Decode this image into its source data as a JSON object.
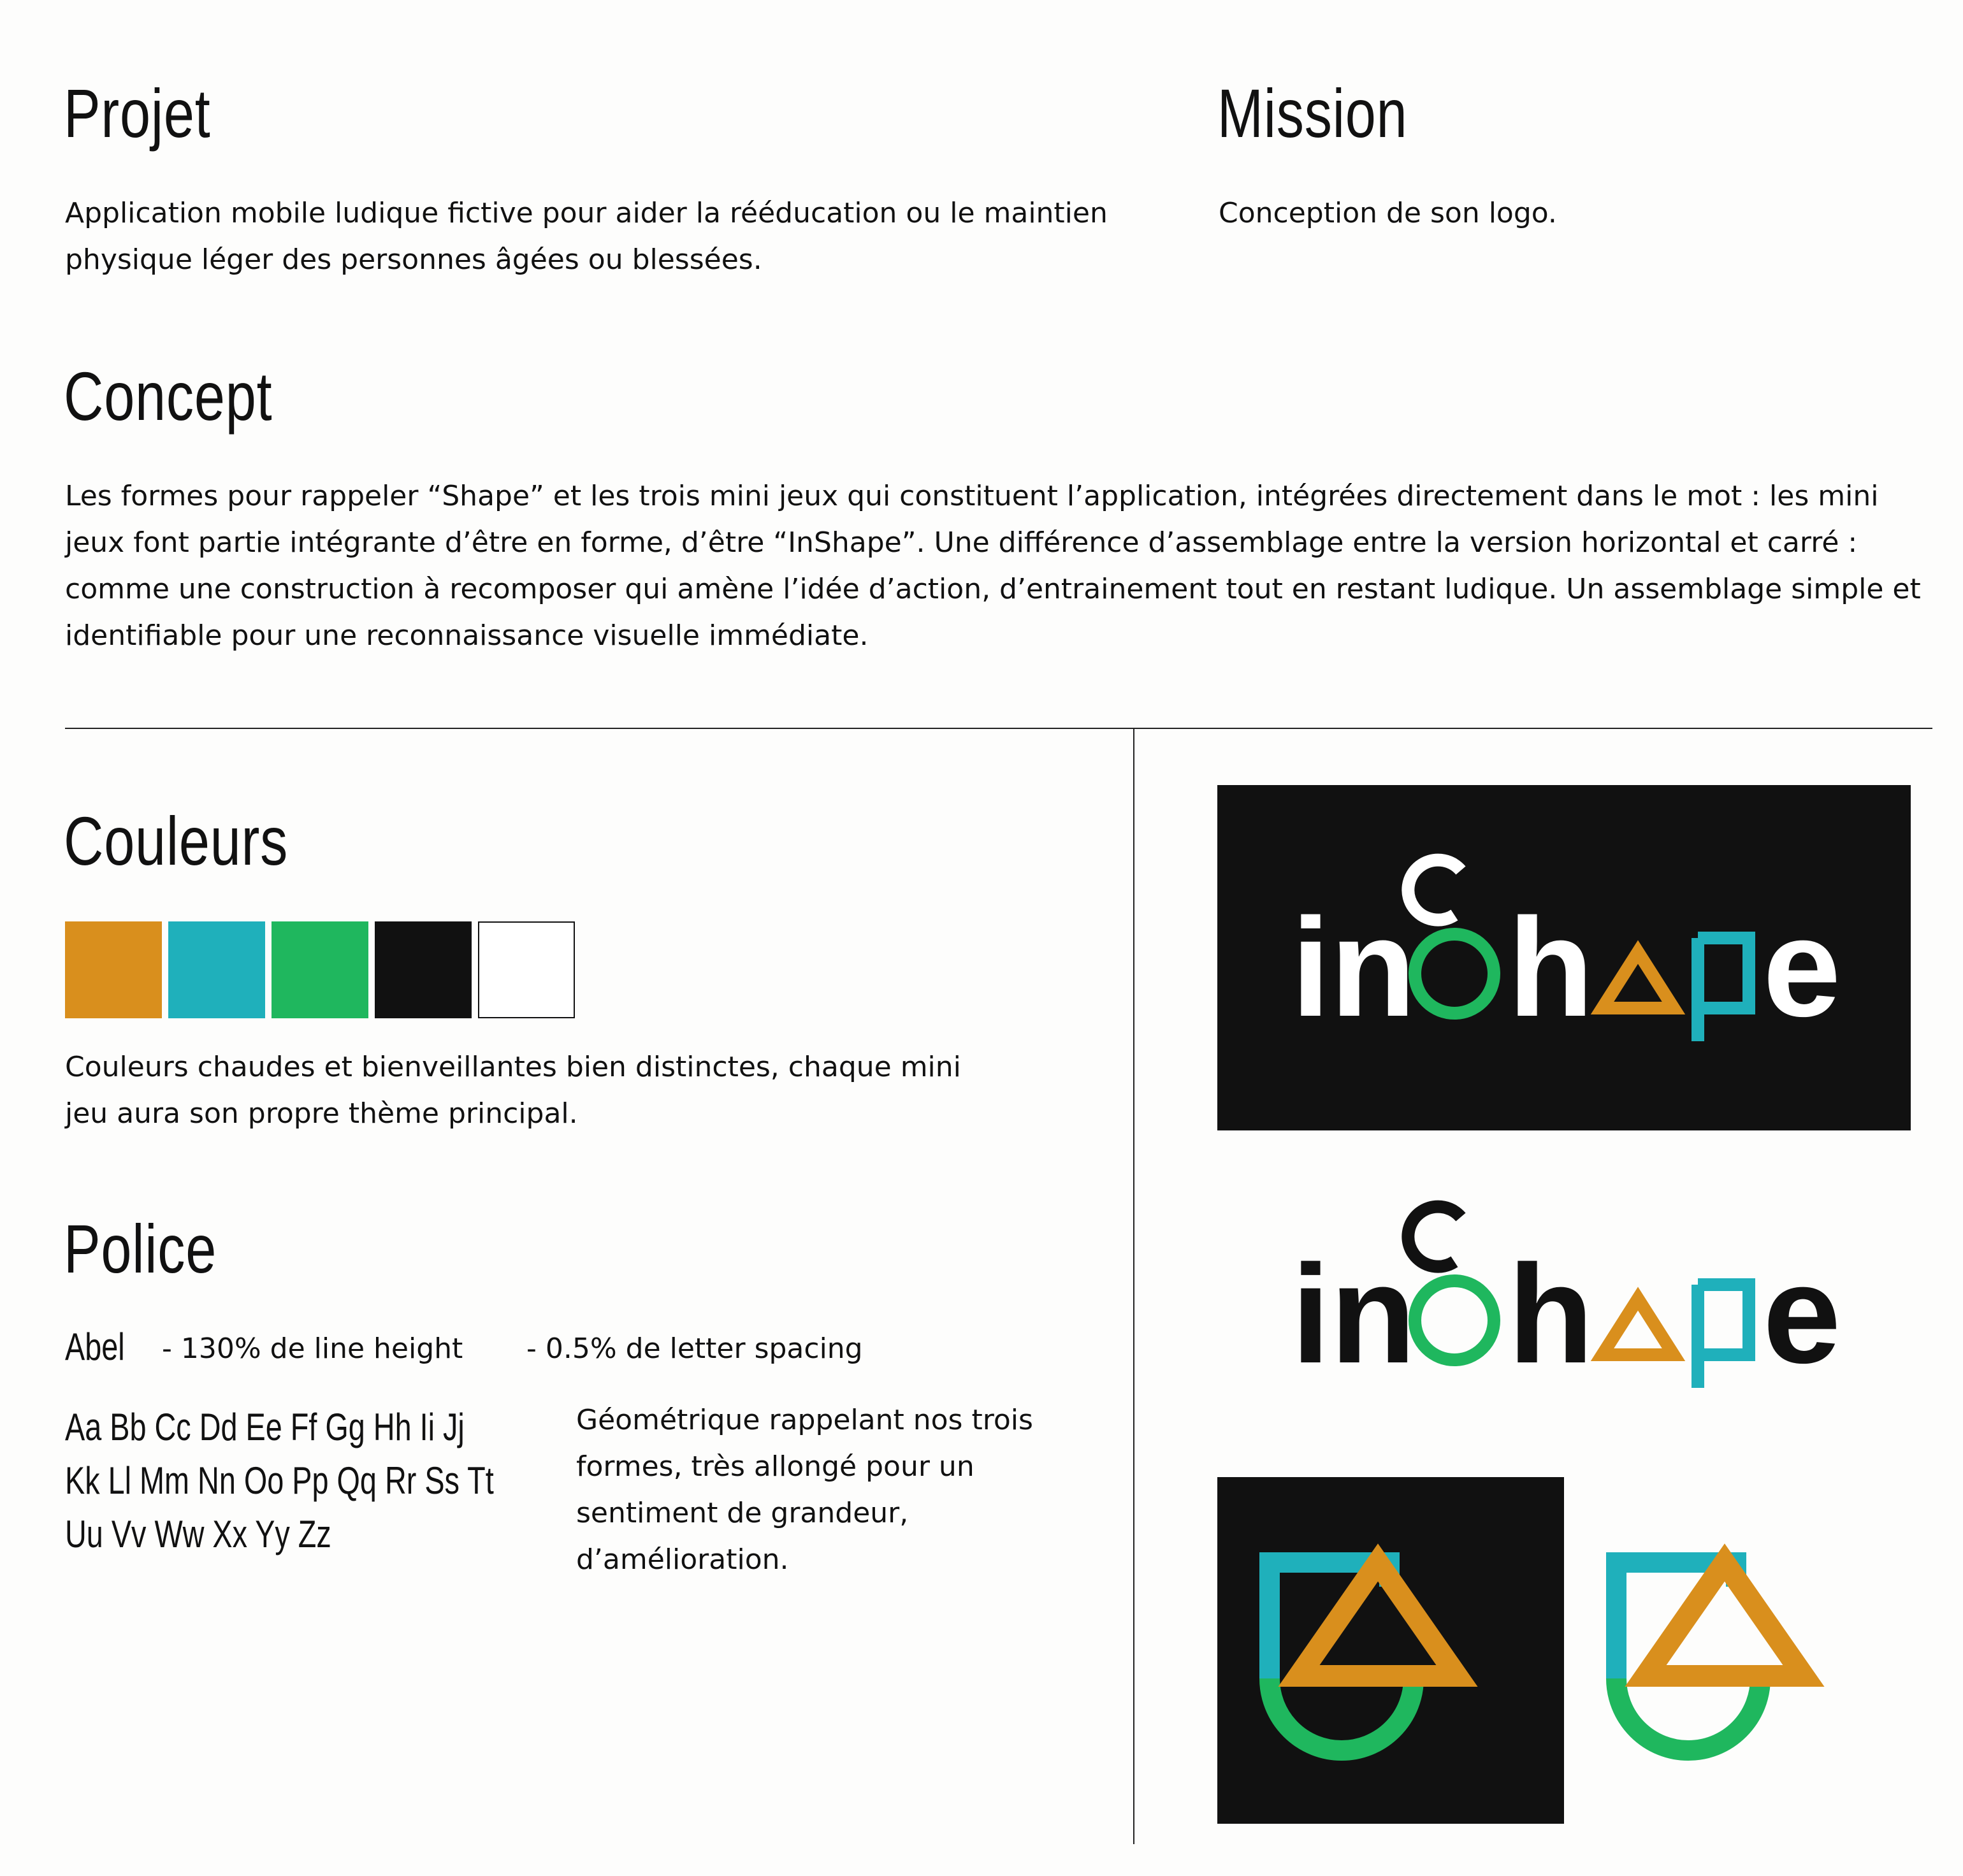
{
  "projet": {
    "title": "Projet",
    "text": "Application mobile ludique fictive pour aider la rééducation ou le maintien physique léger des personnes âgées ou blessées."
  },
  "mission": {
    "title": "Mission",
    "text": "Conception de son logo."
  },
  "concept": {
    "title": "Concept",
    "text": "Les formes pour rappeler “Shape” et les trois mini jeux qui constituent l’application, intégrées directement dans le mot : les mini jeux font partie intégrante d’être en forme, d’être “InShape”. Une différence d’assemblage entre la version horizontal et carré : comme une construction à recomposer qui amène l’idée d’action, d’entrainement tout en restant ludique. Un assemblage simple et identifiable pour une reconnaissance visuelle immédiate."
  },
  "couleurs": {
    "title": "Couleurs",
    "swatches": [
      "#d98f1d",
      "#1fb0bb",
      "#1fb75e",
      "#111111",
      "#ffffff"
    ],
    "text": "Couleurs chaudes et bienveillantes bien distinctes, chaque mini jeu aura son propre thème principal."
  },
  "police": {
    "title": "Police",
    "font_name": "Abel",
    "spec_line_height": "- 130% de line height",
    "spec_letter_spacing": "- 0.5% de letter spacing",
    "alphabet": [
      "Aa Bb Cc Dd Ee Ff Gg Hh Ii Jj",
      "Kk Ll Mm Nn Oo Pp Qq Rr Ss Tt",
      "Uu Vv Ww Xx Yy Zz"
    ],
    "description": "Géométrique rappelant nos trois formes, très allongé pour un sentiment de grandeur, d’amélioration."
  },
  "logo": {
    "letters_a": "in",
    "letter_h": "h",
    "letter_e": "e",
    "colors": {
      "orange": "#d98f1d",
      "teal": "#1fb0bb",
      "green": "#1fb75e",
      "dark": "#111111",
      "light": "#ffffff"
    }
  }
}
